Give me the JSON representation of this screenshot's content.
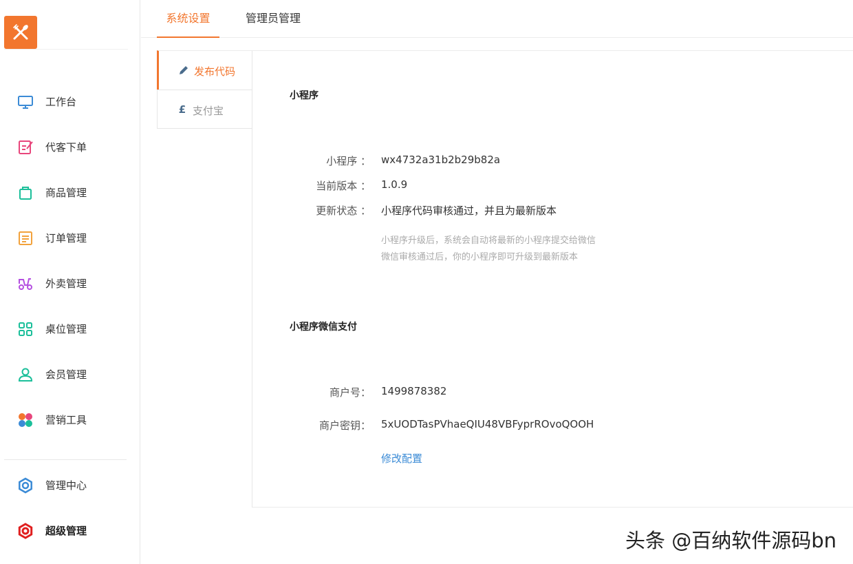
{
  "sidebar": {
    "logo_icon": "fork-knife-icon",
    "items": [
      {
        "label": "工作台",
        "icon": "monitor-icon",
        "color": "#3b8bd6"
      },
      {
        "label": "代客下单",
        "icon": "edit-form-icon",
        "color": "#e8467c"
      },
      {
        "label": "商品管理",
        "icon": "bag-icon",
        "color": "#1bbf9a"
      },
      {
        "label": "订单管理",
        "icon": "list-icon",
        "color": "#f2a23c"
      },
      {
        "label": "外卖管理",
        "icon": "scooter-icon",
        "color": "#b44fe0"
      },
      {
        "label": "桌位管理",
        "icon": "grid-icon",
        "color": "#1bbf9a"
      },
      {
        "label": "会员管理",
        "icon": "user-icon",
        "color": "#1bbf9a"
      },
      {
        "label": "营销工具",
        "icon": "flower-icon",
        "color": "#f2762e"
      },
      {
        "label": "管理中心",
        "icon": "gear-icon",
        "color": "#3b8bd6"
      },
      {
        "label": "超级管理",
        "icon": "gear-icon",
        "color": "#e02020"
      }
    ]
  },
  "top_tabs": [
    {
      "label": "系统设置"
    },
    {
      "label": "管理员管理"
    }
  ],
  "sub_tabs": [
    {
      "label": "发布代码",
      "icon": "pencil-icon"
    },
    {
      "label": "支付宝",
      "icon": "pound-icon"
    }
  ],
  "miniprogram": {
    "title": "小程序",
    "appid_label": "小程序 ：",
    "appid_value": "wx4732a31b2b29b82a",
    "version_label": "当前版本 ：",
    "version_value": "1.0.9",
    "status_label": "更新状态 ：",
    "status_value": "小程序代码审核通过，并且为最新版本",
    "hint_line1": "小程序升级后，系统会自动将最新的小程序提交给微信",
    "hint_line2": "微信审核通过后，你的小程序即可升级到最新版本"
  },
  "wechat_pay": {
    "title": "小程序微信支付",
    "merchant_label": "商户号：",
    "merchant_value": "1499878382",
    "key_label": "商户密钥：",
    "key_value": "5xUODTasPVhaeQIU48VBFyprROvoQOOH",
    "edit_link": "修改配置"
  },
  "watermark": "头条 @百纳软件源码bn",
  "colors": {
    "accent": "#f2762e",
    "link": "#3b8bd6"
  }
}
